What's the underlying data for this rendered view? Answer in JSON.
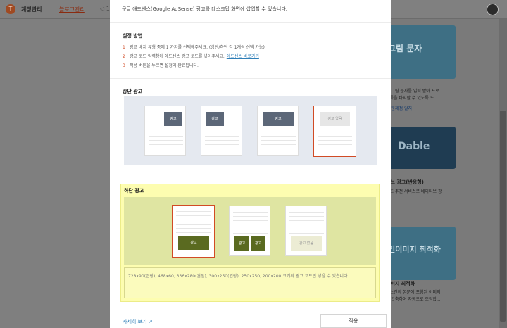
{
  "header": {
    "logo_glyph": "T",
    "title": "계정관리",
    "link": "블로그관리",
    "separator": "|",
    "extra_icon": "◁",
    "extra_text": "1"
  },
  "background": {
    "cards": [
      {
        "title": "그림 문자"
      },
      {
        "title": "Dable"
      },
      {
        "title": "스킨이미지 최적화"
      }
    ],
    "texts": [
      "시 그림 문자를 입력 받아 프로",
      "등록을 바지할 수 있도록 도...",
      "로/문제점 알지",
      "비브 광고(반응형)",
      "텐츠 추천 서비스로 네이티브 광",
      "의",
      "이미지 최적화",
      "테스킨의 본문에 포함된 이미지",
      "만 압축하여 자동으로 조정합..."
    ]
  },
  "modal": {
    "intro": "구글 애드센스(Google AdSense) 광고를 데스크탑 화면에 삽입할 수 있습니다.",
    "steps_title": "설정 방법",
    "steps": [
      {
        "num": "1",
        "text": "광고 배치 유형 중에 1 가지를 선택해주세요. (상단/하단 각 1개씩 선택 가능)",
        "link": ""
      },
      {
        "num": "2",
        "text": "광고 코드 입력창에 애드센스 광고 코드를 넣어주세요.",
        "link": "애드센스 바로가기"
      },
      {
        "num": "3",
        "text": "적용 버튼을 누르면 설정이 완료됩니다.",
        "link": ""
      }
    ],
    "top_title": "상단 광고",
    "bottom_title": "하단 광고",
    "ad_label": "광고",
    "no_ad_label": "광고 없음",
    "code_placeholder": "728x90(권장), 468x60, 336x280(권장), 300x250(권장), 250x250, 200x200 크기의 광고 코드만 넣을 수 있습니다.",
    "footer_link": "자세히 보기",
    "footer_link_icon": "↗",
    "apply": "적용"
  },
  "colors": {
    "accent": "#d14b25",
    "ad_dark": "#5c6778",
    "ad_olive": "#5a6a20",
    "highlight": "#fdfdb0"
  }
}
